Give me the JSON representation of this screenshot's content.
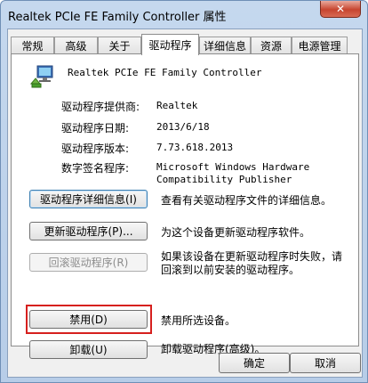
{
  "window": {
    "title": "Realtek PCIe FE Family Controller 属性",
    "close_glyph": "✕"
  },
  "tabs": [
    {
      "label": "常规"
    },
    {
      "label": "高级"
    },
    {
      "label": "关于"
    },
    {
      "label": "驱动程序",
      "active": true
    },
    {
      "label": "详细信息"
    },
    {
      "label": "资源"
    },
    {
      "label": "电源管理"
    }
  ],
  "device": {
    "name": "Realtek PCIe FE Family Controller",
    "icon": "network-adapter-icon"
  },
  "info": [
    {
      "label": "驱动程序提供商:",
      "value": "Realtek"
    },
    {
      "label": "驱动程序日期:",
      "value": "2013/6/18"
    },
    {
      "label": "驱动程序版本:",
      "value": "7.73.618.2013"
    },
    {
      "label": "数字签名程序:",
      "value": "Microsoft Windows Hardware\nCompatibility Publisher"
    }
  ],
  "actions": [
    {
      "button": "驱动程序详细信息(I)",
      "description": "查看有关驱动程序文件的详细信息。"
    },
    {
      "button": "更新驱动程序(P)...",
      "description": "为这个设备更新驱动程序软件。"
    },
    {
      "button": "回滚驱动程序(R)",
      "description": "如果该设备在更新驱动程序时失败，请\n回滚到以前安装的驱动程序。"
    },
    {
      "button": "禁用(D)",
      "description": "禁用所选设备。"
    },
    {
      "button": "卸载(U)",
      "description": "卸载驱动程序(高级)。"
    }
  ],
  "footer": {
    "ok": "确定",
    "cancel": "取消"
  },
  "colors": {
    "highlight_box": "#d6201e"
  }
}
